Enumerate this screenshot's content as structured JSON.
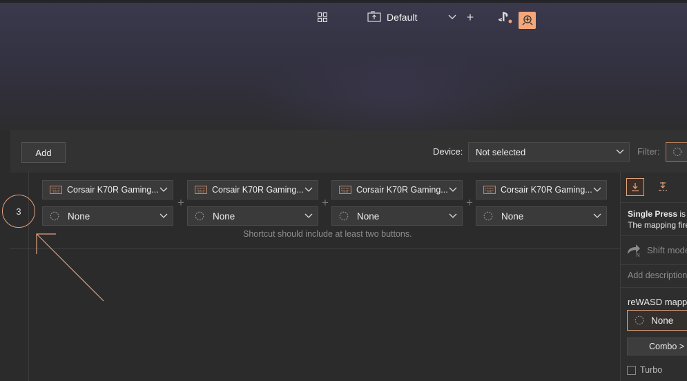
{
  "topbar": {
    "layout_icon": "grid-icon",
    "profile_name": "Default",
    "profile_icon": "config-upload-icon",
    "add_label": "+",
    "controller_icon": "playstation-icon",
    "rewasd_icon": "rewasd-gamepad-icon"
  },
  "toolbar": {
    "add_label": "Add",
    "device_label": "Device:",
    "device_value": "Not selected",
    "filter_label": "Filter:"
  },
  "mapping": {
    "index": "3",
    "keys": [
      {
        "device": "Corsair K70R Gaming...",
        "button": "None"
      },
      {
        "device": "Corsair K70R Gaming...",
        "button": "None"
      },
      {
        "device": "Corsair K70R Gaming...",
        "button": "None"
      },
      {
        "device": "Corsair K70R Gaming...",
        "button": "None"
      }
    ],
    "separator": "+",
    "hint": "Shortcut should include at least two buttons."
  },
  "right_panel": {
    "single_press_bold": "Single Press",
    "single_press_rest": " is f",
    "mapping_fires": "The mapping fire",
    "shift_label": "Shift mode",
    "shift_badge": "N",
    "description_placeholder": "Add description",
    "rewasd_mapping_label": "reWASD mappi",
    "mapping_value": "None",
    "combo_label": "Combo >",
    "turbo_label": "Turbo"
  },
  "colors": {
    "accent": "#e3a27c",
    "background": "#2b2b2c",
    "toolbar": "#323233",
    "control": "#3a3a3b"
  }
}
